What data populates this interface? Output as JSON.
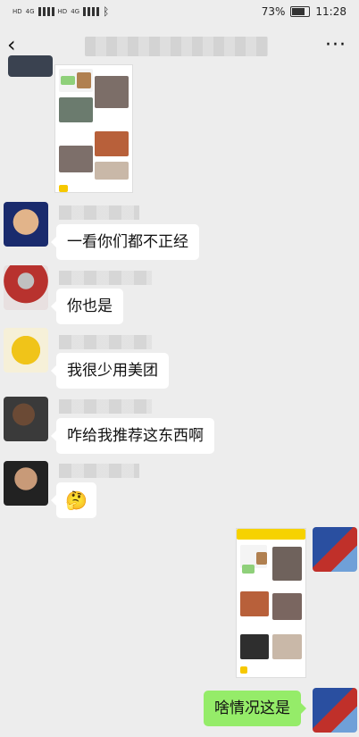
{
  "status": {
    "net_left": "4G",
    "net_right": "4G",
    "hd1": "HD",
    "hd2": "HD",
    "battery": "73%",
    "time": "11:28"
  },
  "header": {
    "back_icon": "chevron-left-icon",
    "more_icon": "more-icon"
  },
  "messages": [
    {
      "side": "left",
      "text": "一看你们都不正经"
    },
    {
      "side": "left",
      "text": "你也是"
    },
    {
      "side": "left",
      "text": "我很少用美团"
    },
    {
      "side": "left",
      "text": "咋给我推荐这东西啊"
    },
    {
      "side": "left",
      "emoji": "🤔"
    },
    {
      "side": "right",
      "text": "啥情况这是"
    }
  ]
}
